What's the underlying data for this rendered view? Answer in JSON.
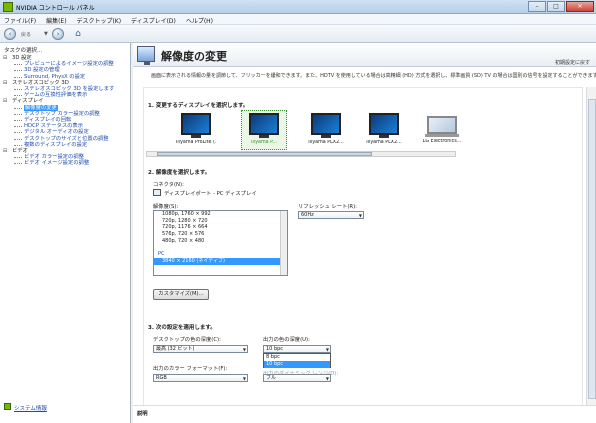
{
  "window": {
    "title": "NVIDIA コントロール パネル",
    "btn_min": "–",
    "btn_max": "□",
    "btn_close": "✕"
  },
  "menu": [
    "ファイル(F)",
    "編集(E)",
    "デスクトップ(K)",
    "ディスプレイ(D)",
    "ヘルプ(H)"
  ],
  "toolbar": {
    "back_label": "戻る",
    "drop": "▼"
  },
  "sidebar": {
    "heading": "タスクの選択...",
    "tree": [
      {
        "level": 0,
        "label": "3D 設定"
      },
      {
        "level": 1,
        "label": "プレビューによるイメージ設定の調整"
      },
      {
        "level": 1,
        "label": "3D 設定の管理"
      },
      {
        "level": 1,
        "label": "Surround, PhysX の設定"
      },
      {
        "level": 0,
        "label": "ステレオスコピック 3D"
      },
      {
        "level": 1,
        "label": "ステレオスコピック 3D を設定します"
      },
      {
        "level": 1,
        "label": "ゲームの互換性評価を表示"
      },
      {
        "level": 0,
        "label": "ディスプレイ"
      },
      {
        "level": 1,
        "label": "解像度の変更",
        "selected": true
      },
      {
        "level": 1,
        "label": "デスクトップ カラー設定の調整"
      },
      {
        "level": 1,
        "label": "ディスプレイの回転"
      },
      {
        "level": 1,
        "label": "HDCP ステータスの表示"
      },
      {
        "level": 1,
        "label": "デジタル オーディオの設定"
      },
      {
        "level": 1,
        "label": "デスクトップのサイズと位置の調整"
      },
      {
        "level": 1,
        "label": "複数のディスプレイの設定"
      },
      {
        "level": 0,
        "label": "ビデオ"
      },
      {
        "level": 1,
        "label": "ビデオ カラー設定の調整"
      },
      {
        "level": 1,
        "label": "ビデオ イメージ設定の調整"
      }
    ],
    "system_info": "システム情報"
  },
  "page": {
    "title": "解像度の変更",
    "restore_defaults": "初期設定に戻す",
    "description": "画面に表示される情報の量を調節して、フリッカーを緩和できます。また、HDTV を使用している場合は高精細 (HD) 方式を選択し、標準画質 (SD) TV の場合は国別の信号を設定することができます。",
    "section1": "1. 変更するディスプレイを選択します。",
    "monitors": [
      {
        "label": "Iiiyama ProLite (1/2)",
        "selected": false
      },
      {
        "label": "Iiiyama P...",
        "selected": true
      },
      {
        "label": "Iiiyama PLX2...",
        "selected": false
      },
      {
        "label": "Iiiyama PLX2...",
        "selected": false
      },
      {
        "label": "LG Electronics...",
        "selected": false
      }
    ],
    "section2": "2. 解像度を選択します。",
    "connector_label": "コネクタ(N):",
    "connector_value": "ディスプレイポート - PC ディスプレイ",
    "resolution_label": "解像度(S):",
    "resolutions": [
      {
        "text": "1080p, 1760 × 992",
        "group": false
      },
      {
        "text": "720p, 1280 × 720",
        "group": false
      },
      {
        "text": "720p, 1176 × 664",
        "group": false
      },
      {
        "text": "576p, 720 × 576",
        "group": false
      },
      {
        "text": "480p, 720 × 480",
        "group": false
      },
      {
        "text": "",
        "group": false
      },
      {
        "text": "PC",
        "group": true
      },
      {
        "text": "3840 × 2160 (ネイティブ)",
        "group": false,
        "selected": true
      }
    ],
    "refresh_label": "リフレッシュ レート(R):",
    "refresh_value": "60Hz",
    "customize_btn": "カスタマイズ(M)...",
    "section3": "3. 次の設定を適用します。",
    "desktop_depth_label": "デスクトップの色の深度(C):",
    "desktop_depth_value": "最高 (32 ビット)",
    "output_depth_label": "出力の色の深度(U):",
    "output_depth_value": "10 bpc",
    "output_depth_options": [
      "8 bpc",
      "10 bpc"
    ],
    "output_format_label": "出力のカラー フォーマット(F):",
    "output_format_value": "RGB",
    "output_range_label": "出力のダイナミック レンジ(D):",
    "output_range_value": "フル",
    "explanation_label": "説明"
  }
}
